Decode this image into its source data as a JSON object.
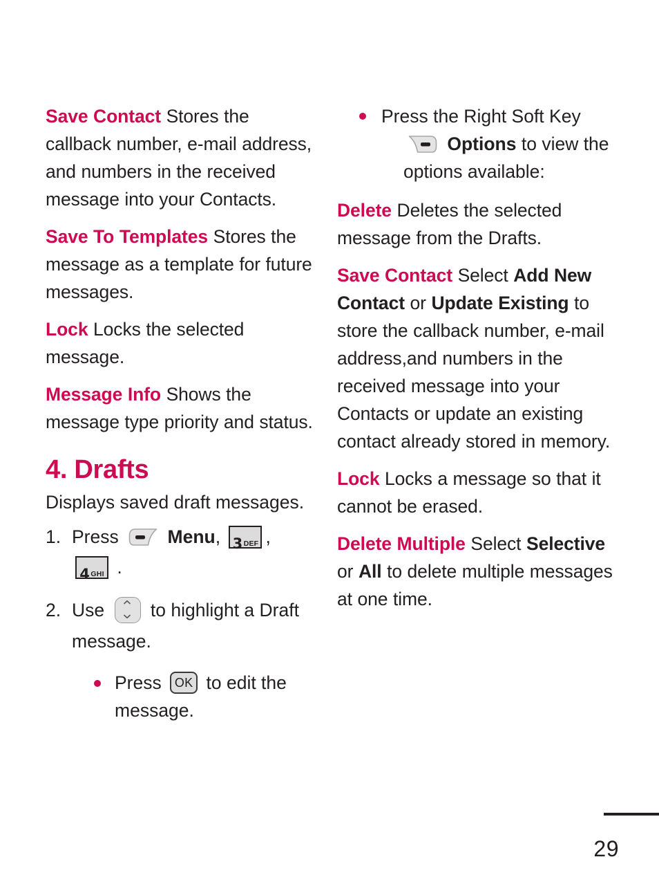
{
  "document": {
    "page_number": "29",
    "accent_color": "#ce0a52",
    "text_color": "#231f20"
  },
  "left_column": {
    "entries": [
      {
        "term": "Save Contact",
        "description": "Stores the callback number, e-mail address, and numbers in the received message into your Contacts."
      },
      {
        "term": "Save To Templates",
        "description": "Stores the message as a template for future messages."
      },
      {
        "term": "Lock",
        "description": "Locks the selected message."
      },
      {
        "term": "Message Info",
        "description": "Shows the message type priority and status."
      }
    ],
    "section": {
      "heading": "4. Drafts",
      "intro": "Displays saved draft messages.",
      "steps": [
        {
          "number": "1.",
          "text_before_softkey": "Press",
          "softkey_label": "Menu",
          "text_after_softkey": ",",
          "keys": [
            {
              "digit": "3",
              "letters": "DEF"
            },
            {
              "digit": "4",
              "letters": "GHI"
            }
          ],
          "separator": ",",
          "terminator": "."
        },
        {
          "number": "2.",
          "text_before_key": "Use",
          "text_after_key": "to highlight a Draft message.",
          "nav_key_name": "up-down-navigation-key",
          "sub_bullets": [
            {
              "text_before_key": "Press",
              "key_label": "OK",
              "text_after_key": "to edit the message."
            }
          ]
        }
      ]
    }
  },
  "right_column": {
    "intro_bullet": {
      "line1": "Press the Right Soft Key",
      "softkey_label": "Options",
      "line2_after_label": "to view the",
      "line3": "options available:"
    },
    "entries": [
      {
        "term": "Delete",
        "description": "Deletes the selected message from the Drafts."
      },
      {
        "term": "Save Contact",
        "desc_part1": "Select ",
        "bold1": "Add New Contact",
        "desc_part2": " or ",
        "bold2": "Update Existing",
        "desc_part3": " to store the callback number, e-mail address,and numbers in the received message into your Contacts or update an existing contact already stored in memory."
      },
      {
        "term": "Lock",
        "description": "Locks a message so that it cannot be erased."
      },
      {
        "term": "Delete Multiple",
        "desc_part1": "Select ",
        "bold1": "Selective",
        "desc_part2": " or ",
        "bold2": "All",
        "desc_part3": " to delete multiple messages at one time."
      }
    ]
  },
  "icons": {
    "left_soft_key": "left-soft-key-icon",
    "right_soft_key": "right-soft-key-icon",
    "nav_key": "navigation-key-icon",
    "ok_key": "ok-key-icon"
  }
}
